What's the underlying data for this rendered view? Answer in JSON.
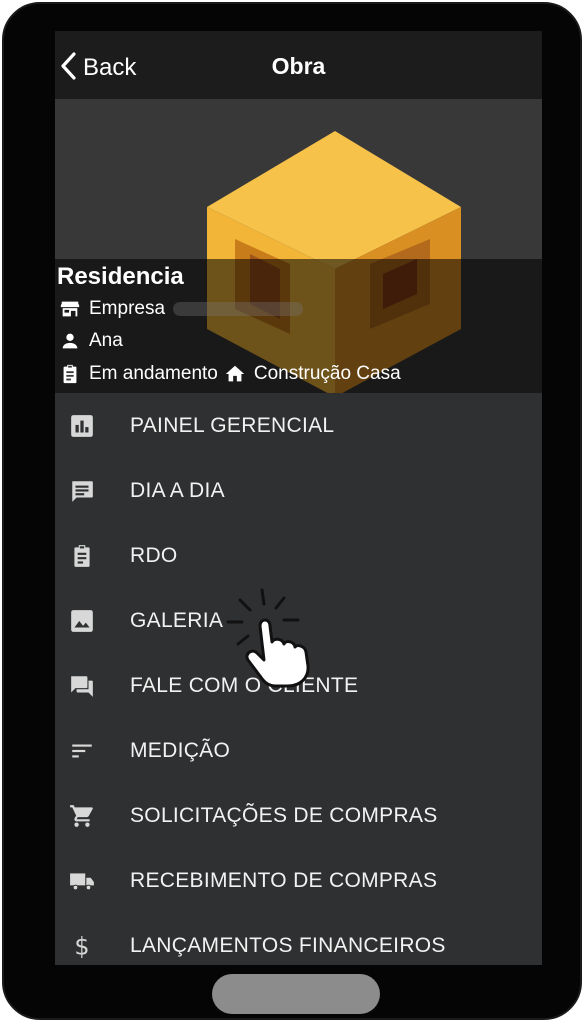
{
  "navbar": {
    "back_label": "Back",
    "title": "Obra"
  },
  "project": {
    "name": "Residencia",
    "company_label": "Empresa",
    "user": "Ana",
    "status": "Em andamento",
    "type": "Construção Casa"
  },
  "menu": {
    "items": [
      {
        "label": "PAINEL GERENCIAL",
        "icon": "bar-chart-icon"
      },
      {
        "label": "DIA A DIA",
        "icon": "message-icon"
      },
      {
        "label": "RDO",
        "icon": "clipboard-icon"
      },
      {
        "label": "GALERIA",
        "icon": "image-icon"
      },
      {
        "label": "FALE COM O CLIENTE",
        "icon": "chat-icon"
      },
      {
        "label": "MEDIÇÃO",
        "icon": "sort-lines-icon"
      },
      {
        "label": "SOLICITAÇÕES DE COMPRAS",
        "icon": "shopping-cart-icon"
      },
      {
        "label": "RECEBIMENTO DE COMPRAS",
        "icon": "truck-icon"
      },
      {
        "label": "LANÇAMENTOS FINANCEIROS",
        "icon": "dollar-icon"
      }
    ]
  },
  "colors": {
    "accent": "#f0b43c",
    "screen_bg": "#2f3031",
    "navbar_bg": "#1c1c1c"
  }
}
